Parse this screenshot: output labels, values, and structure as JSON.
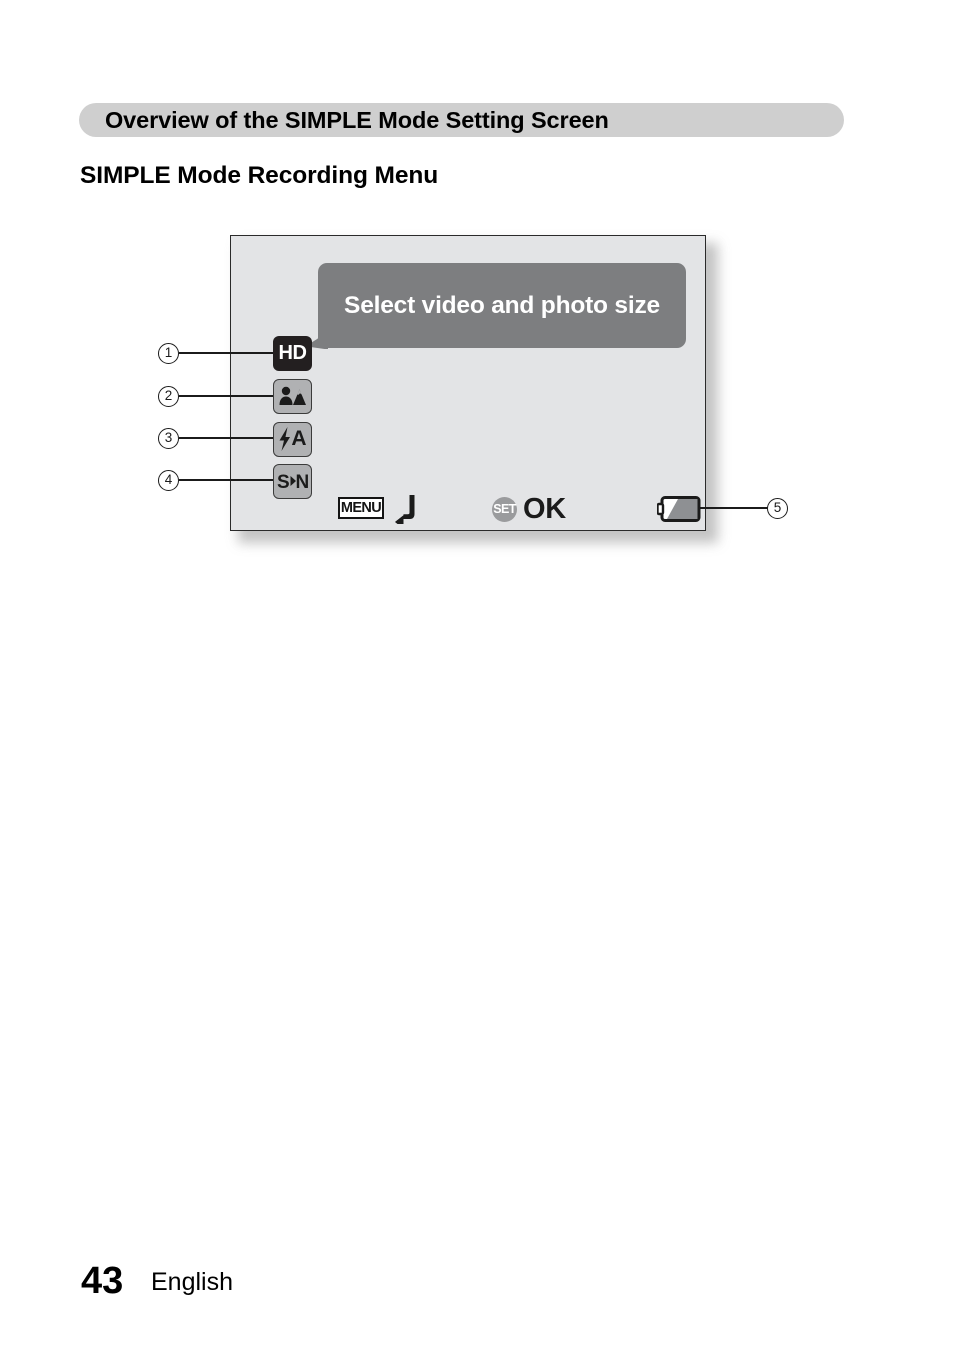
{
  "page": {
    "section_title": "Overview of the SIMPLE Mode Setting Screen",
    "sub_heading": "SIMPLE Mode Recording Menu",
    "page_number": "43",
    "language": "English"
  },
  "camera_screen": {
    "tooltip": {
      "text": "Select video and photo size",
      "bg_color": "#7d7e80",
      "text_color": "#ffffff"
    },
    "status_icons": [
      {
        "id": "video-photo-size",
        "label": "HD",
        "icon_name": "hd-resolution-icon",
        "callout": "1",
        "style": "dark"
      },
      {
        "id": "scene-select",
        "label": "",
        "icon_name": "scene-select-person-mountain-icon",
        "callout": "2",
        "style": "light"
      },
      {
        "id": "flash-mode",
        "label": "A",
        "icon_name": "flash-auto-icon",
        "callout": "3",
        "style": "light"
      },
      {
        "id": "mode-switch",
        "label": "S N",
        "icon_name": "simple-to-normal-mode-icon",
        "callout": "4",
        "style": "light"
      }
    ],
    "guide_bar": {
      "menu_label": "MENU",
      "menu_action_icon": "return-arrow-icon",
      "set_label": "SET",
      "set_action_label": "OK",
      "battery": {
        "icon_name": "battery-level-icon",
        "callout": "5"
      }
    }
  },
  "callouts": [
    {
      "number": "1"
    },
    {
      "number": "2"
    },
    {
      "number": "3"
    },
    {
      "number": "4"
    },
    {
      "number": "5"
    }
  ]
}
